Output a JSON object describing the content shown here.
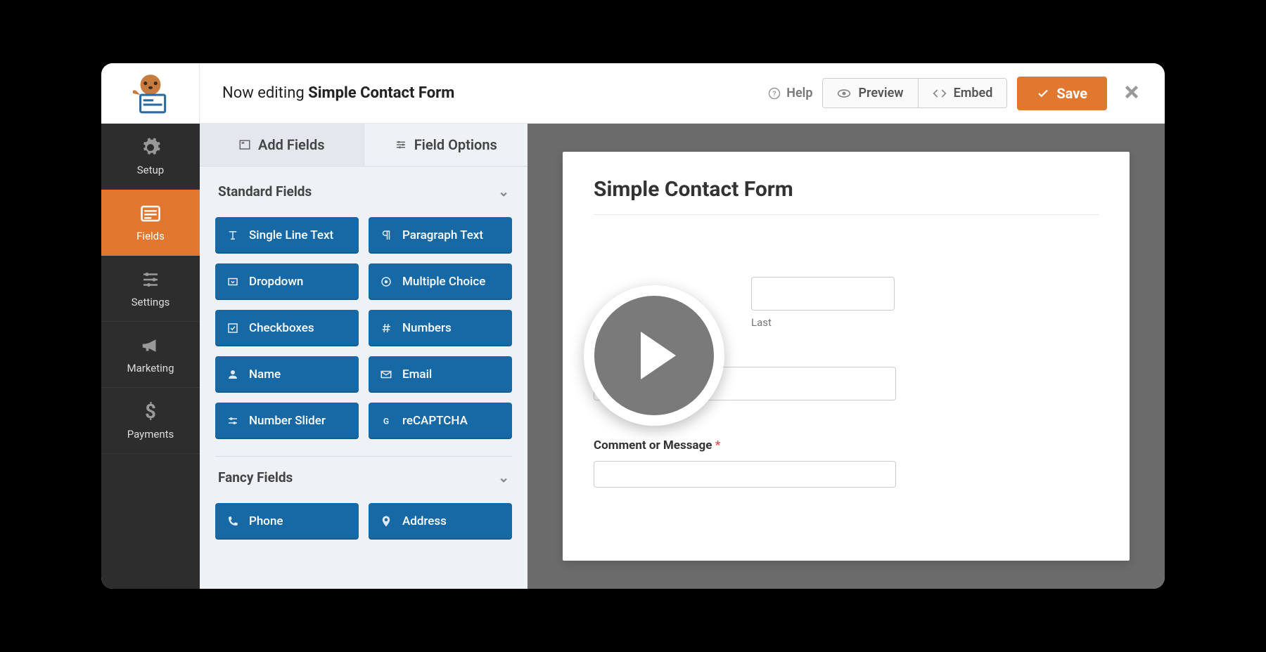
{
  "header": {
    "editing_prefix": "Now editing",
    "form_name": "Simple Contact Form",
    "help": "Help",
    "preview": "Preview",
    "embed": "Embed",
    "save": "Save"
  },
  "sidebar": {
    "items": [
      {
        "label": "Setup",
        "icon": "gear"
      },
      {
        "label": "Fields",
        "icon": "form"
      },
      {
        "label": "Settings",
        "icon": "sliders"
      },
      {
        "label": "Marketing",
        "icon": "bullhorn"
      },
      {
        "label": "Payments",
        "icon": "dollar"
      }
    ],
    "active_index": 1
  },
  "panel": {
    "tabs": {
      "add_fields": "Add Fields",
      "field_options": "Field Options",
      "active": "add_fields"
    },
    "sections": [
      {
        "title": "Standard Fields",
        "fields": [
          {
            "label": "Single Line Text",
            "icon": "text"
          },
          {
            "label": "Paragraph Text",
            "icon": "paragraph"
          },
          {
            "label": "Dropdown",
            "icon": "dropdown"
          },
          {
            "label": "Multiple Choice",
            "icon": "radio"
          },
          {
            "label": "Checkboxes",
            "icon": "check"
          },
          {
            "label": "Numbers",
            "icon": "hash"
          },
          {
            "label": "Name",
            "icon": "user"
          },
          {
            "label": "Email",
            "icon": "mail"
          },
          {
            "label": "Number Slider",
            "icon": "slider"
          },
          {
            "label": "reCAPTCHA",
            "icon": "g"
          }
        ]
      },
      {
        "title": "Fancy Fields",
        "fields": [
          {
            "label": "Phone",
            "icon": "phone"
          },
          {
            "label": "Address",
            "icon": "pin"
          }
        ]
      }
    ]
  },
  "preview": {
    "title": "Simple Contact Form",
    "name_last_label": "Last",
    "comment_label": "Comment or Message"
  },
  "colors": {
    "accent": "#e27730",
    "field_blue": "#1769a5"
  }
}
